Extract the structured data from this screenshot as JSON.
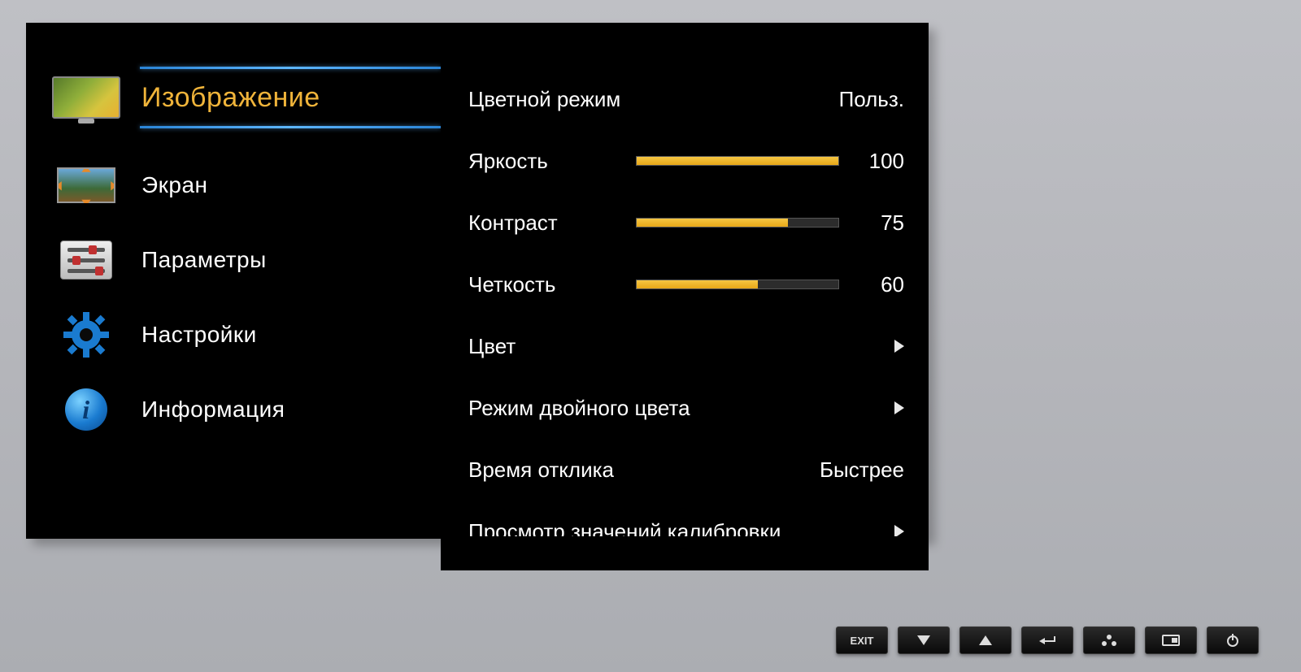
{
  "sidebar": {
    "items": [
      {
        "label": "Изображение",
        "active": true
      },
      {
        "label": "Экран"
      },
      {
        "label": "Параметры"
      },
      {
        "label": "Настройки"
      },
      {
        "label": "Информация"
      }
    ]
  },
  "panel": {
    "color_mode": {
      "label": "Цветной режим",
      "value": "Польз."
    },
    "brightness": {
      "label": "Яркость",
      "value": 100
    },
    "contrast": {
      "label": "Контраст",
      "value": 75
    },
    "sharpness": {
      "label": "Четкость",
      "value": 60
    },
    "color": {
      "label": "Цвет"
    },
    "dual_color": {
      "label": "Режим двойного цвета"
    },
    "response": {
      "label": "Время отклика",
      "value": "Быстрее"
    },
    "calibration": {
      "label": "Просмотр значений калибровки"
    }
  },
  "hw": {
    "exit": "EXIT"
  }
}
